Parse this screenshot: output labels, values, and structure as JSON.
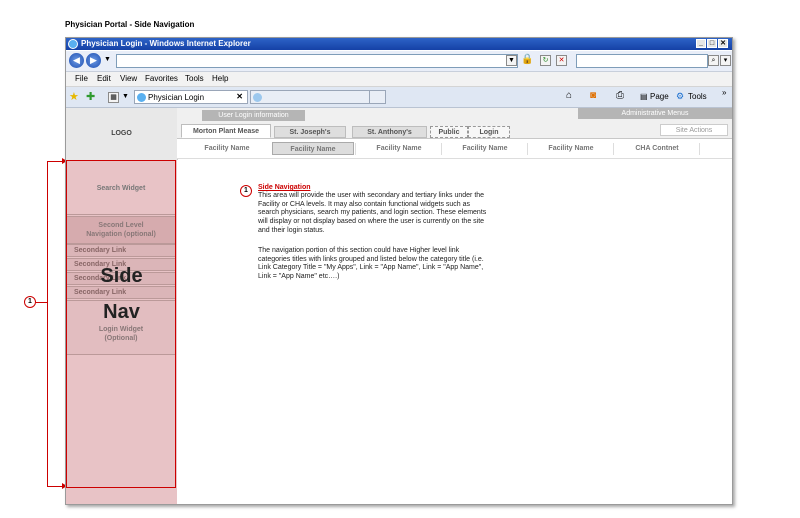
{
  "page_heading": "Physician Portal - Side Navigation",
  "browser": {
    "window_title": "Physician Login - Windows Internet Explorer",
    "menu": [
      "File",
      "Edit",
      "View",
      "Favorites",
      "Tools",
      "Help"
    ],
    "tab_title": "Physician Login",
    "toolbar": {
      "page_label": "Page",
      "tools_label": "Tools"
    }
  },
  "portal": {
    "logo": "LOGO",
    "user_login_info": "User Login information",
    "admin_menus": "Administrative Menus",
    "tabs": [
      {
        "label": "Morton Plant Mease"
      },
      {
        "label": "St. Joseph's"
      },
      {
        "label": "St. Anthony's"
      },
      {
        "label": "Public"
      },
      {
        "label": "Login"
      }
    ],
    "site_actions": "Site Actions",
    "facilities": [
      "Facility Name",
      "Facility Name",
      "Facility Name",
      "Facility Name",
      "Facility Name",
      "CHA Contnet"
    ]
  },
  "sidenav": {
    "search_widget": "Search Widget",
    "second_level_line1": "Second Level",
    "second_level_line2": "Navigation (optional)",
    "secondary_links": [
      "Secondary Link",
      "Secondary Link",
      "Secondary Link",
      "Secondary Link"
    ],
    "big_label_1": "Side",
    "big_label_2": "Nav",
    "login_widget_line1": "Login Widget",
    "login_widget_line2": "(Optional)"
  },
  "annotation": {
    "number": "1",
    "title": "Side Navigation",
    "para1": "This area will provide the user with secondary and tertiary links under the Facility or CHA levels. It may also contain functional widgets such as search physicians, search my patients, and login section. These elements will display or not display based on where the user is currently on the site and their login status.",
    "para2": "The navigation portion of this section could have Higher level link categories titles with links grouped and listed below the category title (i.e. Link Category Title = \"My Apps\",  Link = \"App Name\", Link = \"App Name\", Link = \"App Name\" etc….)"
  }
}
